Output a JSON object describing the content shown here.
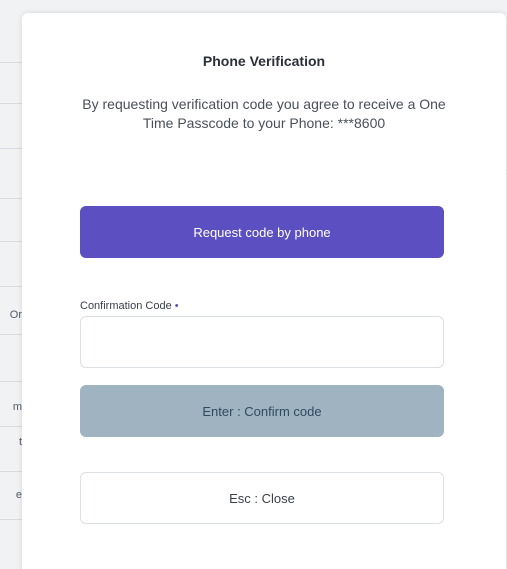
{
  "modal": {
    "title": "Phone Verification",
    "description": "By requesting verification code you agree to receive a One Time Passcode to your Phone: ***8600",
    "request_button": "Request code by phone",
    "confirmation_field": {
      "label": "Confirmation Code",
      "required_marker": "•",
      "value": ""
    },
    "confirm_button": "Enter : Confirm code",
    "close_button": "Esc : Close"
  },
  "background": {
    "fragments": [
      "Or",
      "m",
      "t",
      "e"
    ]
  },
  "colors": {
    "primary": "#5b4fc2",
    "confirm_disabled": "#9fb3c0",
    "border": "#dcdfe5"
  }
}
